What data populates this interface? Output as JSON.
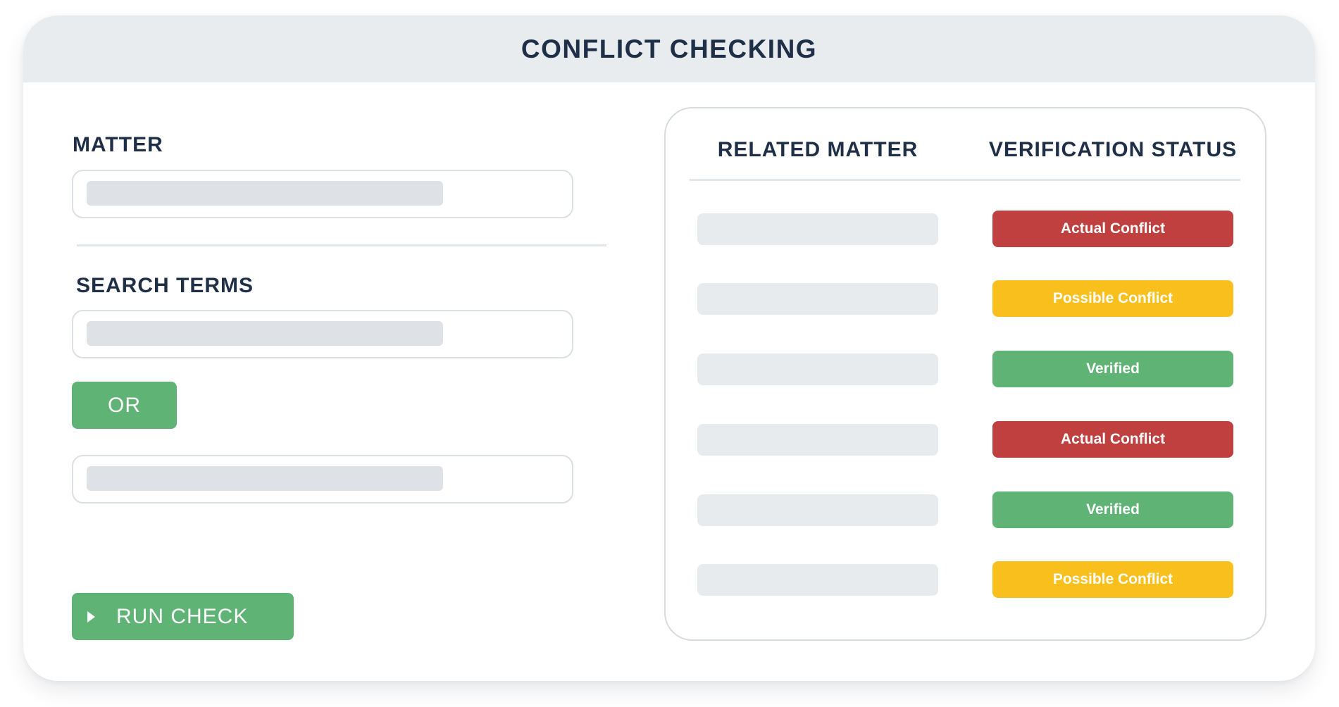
{
  "header": {
    "title": "CONFLICT CHECKING"
  },
  "left": {
    "matter_label": "MATTER",
    "matter_input_value": "",
    "search_terms_label": "SEARCH TERMS",
    "search_term_1_value": "",
    "or_button_label": "OR",
    "search_term_2_value": "",
    "run_check_label": "RUN CHECK",
    "run_check_icon": "play-icon"
  },
  "results": {
    "columns": [
      "RELATED MATTER",
      "VERIFICATION STATUS"
    ],
    "rows": [
      {
        "related_matter": "",
        "status": "Actual Conflict",
        "status_type": "actual"
      },
      {
        "related_matter": "",
        "status": "Possible Conflict",
        "status_type": "possible"
      },
      {
        "related_matter": "",
        "status": "Verified",
        "status_type": "verified"
      },
      {
        "related_matter": "",
        "status": "Actual Conflict",
        "status_type": "actual"
      },
      {
        "related_matter": "",
        "status": "Verified",
        "status_type": "verified"
      },
      {
        "related_matter": "",
        "status": "Possible Conflict",
        "status_type": "possible"
      }
    ]
  },
  "colors": {
    "actual": "#c03f3f",
    "possible": "#f9c01d",
    "verified": "#5fb374",
    "title_text": "#1f2f47",
    "header_bg": "#e8ecef"
  }
}
